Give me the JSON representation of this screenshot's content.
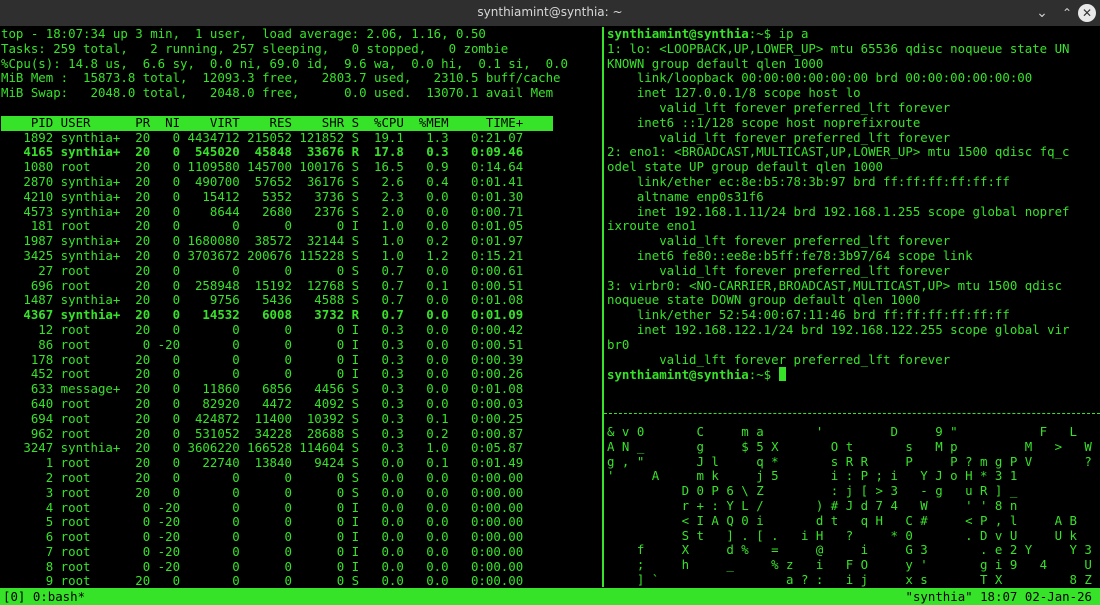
{
  "window": {
    "title": "synthiamint@synthia: ~",
    "minimize_glyph": "⌄",
    "maximize_glyph": "⌃",
    "close_glyph": "✕"
  },
  "colors": {
    "terminal_fg": "#37e329",
    "terminal_bg": "#000000",
    "titlebar_bg": "#2f2f2f"
  },
  "top": {
    "summary": [
      "top - 18:07:34 up 3 min,  1 user,  load average: 2.06, 1.16, 0.50",
      "Tasks: 259 total,   2 running, 257 sleeping,   0 stopped,   0 zombie",
      "%Cpu(s): 14.8 us,  6.6 sy,  0.0 ni, 69.0 id,  9.6 wa,  0.0 hi,  0.1 si,  0.0",
      "MiB Mem :  15873.8 total,  12093.3 free,   2803.7 used,   2310.5 buff/cache",
      "MiB Swap:   2048.0 total,   2048.0 free,      0.0 used.  13070.1 avail Mem"
    ],
    "header": "    PID USER      PR  NI    VIRT    RES    SHR S  %CPU  %MEM     TIME+",
    "processes": [
      {
        "text": "   1892 synthia+  20   0 4434712 215052 121852 S  19.1   1.3   0:21.07",
        "bold": false
      },
      {
        "text": "   4165 synthia+  20   0  545020  45848  33676 R  17.8   0.3   0:09.46",
        "bold": true
      },
      {
        "text": "   1080 root      20   0 1109580 145700 100176 S  16.5   0.9   0:14.64",
        "bold": false
      },
      {
        "text": "   2870 synthia+  20   0  490700  57652  36176 S   2.6   0.4   0:01.41",
        "bold": false
      },
      {
        "text": "   4210 synthia+  20   0   15412   5352   3736 S   2.3   0.0   0:01.30",
        "bold": false
      },
      {
        "text": "   4573 synthia+  20   0    8644   2680   2376 S   2.0   0.0   0:00.71",
        "bold": false
      },
      {
        "text": "    181 root      20   0       0      0      0 I   1.0   0.0   0:01.05",
        "bold": false
      },
      {
        "text": "   1987 synthia+  20   0 1680080  38572  32144 S   1.0   0.2   0:01.97",
        "bold": false
      },
      {
        "text": "   3425 synthia+  20   0 3703672 200676 115228 S   1.0   1.2   0:15.21",
        "bold": false
      },
      {
        "text": "     27 root      20   0       0      0      0 S   0.7   0.0   0:00.61",
        "bold": false
      },
      {
        "text": "    696 root      20   0  258948  15192  12768 S   0.7   0.1   0:00.51",
        "bold": false
      },
      {
        "text": "   1487 synthia+  20   0    9756   5436   4588 S   0.7   0.0   0:01.08",
        "bold": false
      },
      {
        "text": "   4367 synthia+  20   0   14532   6008   3732 R   0.7   0.0   0:01.09",
        "bold": true
      },
      {
        "text": "     12 root      20   0       0      0      0 I   0.3   0.0   0:00.42",
        "bold": false
      },
      {
        "text": "     86 root       0 -20       0      0      0 I   0.3   0.0   0:00.51",
        "bold": false
      },
      {
        "text": "    178 root      20   0       0      0      0 I   0.3   0.0   0:00.39",
        "bold": false
      },
      {
        "text": "    452 root      20   0       0      0      0 I   0.3   0.0   0:00.26",
        "bold": false
      },
      {
        "text": "    633 message+  20   0   11860   6856   4456 S   0.3   0.0   0:01.08",
        "bold": false
      },
      {
        "text": "    640 root      20   0   82920   4472   4092 S   0.3   0.0   0:00.03",
        "bold": false
      },
      {
        "text": "    694 root      20   0  424872  11400  10392 S   0.3   0.1   0:00.25",
        "bold": false
      },
      {
        "text": "    962 root      20   0  531052  34228  28688 S   0.3   0.2   0:00.87",
        "bold": false
      },
      {
        "text": "   3247 synthia+  20   0 3606220 166528 114604 S   0.3   1.0   0:05.87",
        "bold": false
      },
      {
        "text": "      1 root      20   0   22740  13840   9424 S   0.0   0.1   0:01.49",
        "bold": false
      },
      {
        "text": "      2 root      20   0       0      0      0 S   0.0   0.0   0:00.00",
        "bold": false
      },
      {
        "text": "      3 root      20   0       0      0      0 S   0.0   0.0   0:00.00",
        "bold": false
      },
      {
        "text": "      4 root       0 -20       0      0      0 I   0.0   0.0   0:00.00",
        "bold": false
      },
      {
        "text": "      5 root       0 -20       0      0      0 I   0.0   0.0   0:00.00",
        "bold": false
      },
      {
        "text": "      6 root       0 -20       0      0      0 I   0.0   0.0   0:00.00",
        "bold": false
      },
      {
        "text": "      7 root       0 -20       0      0      0 I   0.0   0.0   0:00.00",
        "bold": false
      },
      {
        "text": "      8 root       0 -20       0      0      0 I   0.0   0.0   0:00.00",
        "bold": false
      },
      {
        "text": "      9 root      20   0       0      0      0 S   0.0   0.0   0:00.00",
        "bold": false
      }
    ]
  },
  "ip_pane": {
    "prompt_user": "synthiamint@synthia",
    "prompt_path": ":~$ ",
    "command": "ip a",
    "output": [
      "1: lo: <LOOPBACK,UP,LOWER_UP> mtu 65536 qdisc noqueue state UN",
      "KNOWN group default qlen 1000",
      "    link/loopback 00:00:00:00:00:00 brd 00:00:00:00:00:00",
      "    inet 127.0.0.1/8 scope host lo",
      "       valid_lft forever preferred_lft forever",
      "    inet6 ::1/128 scope host noprefixroute",
      "       valid_lft forever preferred_lft forever",
      "2: eno1: <BROADCAST,MULTICAST,UP,LOWER_UP> mtu 1500 qdisc fq_c",
      "odel state UP group default qlen 1000",
      "    link/ether ec:8e:b5:78:3b:97 brd ff:ff:ff:ff:ff:ff",
      "    altname enp0s31f6",
      "    inet 192.168.1.11/24 brd 192.168.1.255 scope global nopref",
      "ixroute eno1",
      "       valid_lft forever preferred_lft forever",
      "    inet6 fe80::ee8e:b5ff:fe78:3b97/64 scope link",
      "       valid_lft forever preferred_lft forever",
      "3: virbr0: <NO-CARRIER,BROADCAST,MULTICAST,UP> mtu 1500 qdisc",
      "noqueue state DOWN group default qlen 1000",
      "    link/ether 52:54:00:67:11:46 brd ff:ff:ff:ff:ff:ff",
      "    inet 192.168.122.1/24 brd 192.168.122.255 scope global vir",
      "br0",
      "       valid_lft forever preferred_lft forever"
    ]
  },
  "matrix_pane": {
    "lines": [
      "& v 0       C     m a       '         D     9 \"           F   L",
      "A N _       g     $ 5 X       O t       s   M p         M   >   W",
      "g , \"       J l     q *       s R R     P     P ? m g P V       ?",
      "'     A     m k     j 5       i : P ; i   Y J o H * 3 1",
      "          D 0 P 6 \\ Z         : j [ > 3   - g   u R ] _",
      "          r + : Y L /       ) # J d 7 4   W     ' ' 8 n",
      "          < I A Q 0 i       d t   q H   C #     < P , l     A B",
      "          S t   ] . [ .   i H   ?     * 0       . D v U     U k",
      "    f     X     d %   =     @     i     G 3       . e 2 Y     Y 3",
      "    ;     h     _     % z   i   F O     y '       g i 9   4     U",
      "    ] `                 a ? :   i j     x s       T X         8 Z"
    ]
  },
  "statusbar": {
    "left": "[0] 0:bash*",
    "right": "\"synthia\" 18:07 02-Jan-26"
  }
}
